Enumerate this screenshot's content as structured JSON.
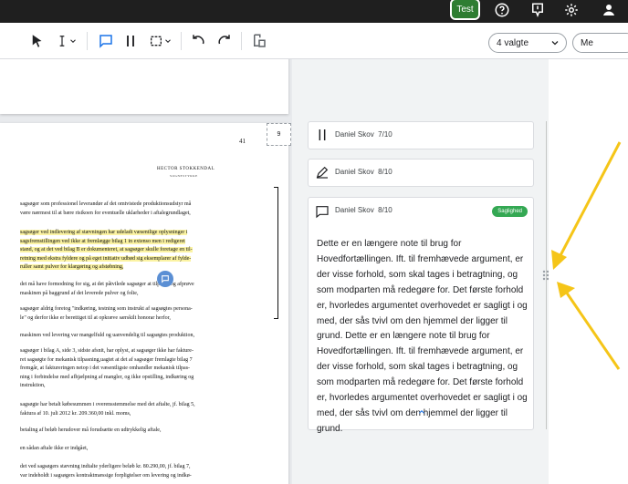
{
  "topbar": {
    "test_label": "Test",
    "icons": [
      "help-icon",
      "feedback-icon",
      "settings-icon",
      "account-icon"
    ]
  },
  "toolbar": {
    "icons": [
      "pointer-icon",
      "text-cursor-icon",
      "comment-icon",
      "columns-icon",
      "selection-icon",
      "undo-icon",
      "redo-icon",
      "export-icon"
    ],
    "filter_select": "4 valgte",
    "user_select": "Me"
  },
  "document": {
    "page_number": "41",
    "page_box": "9",
    "header_line1": "HECTOR STOKKENDAL",
    "header_line2": "SOGNESTYRKE",
    "paragraphs": [
      "sagsøger som professionel leverandør af det omtvistede produktionsudstyr må\nvære nærmest til at bære risikoen for eventuelle uklarheder i aftalegrundlaget,",
      "sagsøger ved indlevering af stævningen har udeladt væsentlige oplysninger i\nsagsfremstillingen ved ikke at fremlægge bilag 1 in extenso men i redigeret\nstand, og at det ved bilag B er dokumenteret, at sagsøger skulle foretage en til-\nretning med ekstra fyldere og på eget initiativ udbød sig eksemplarer af fylde-\nruller samt pulver for klargøring og afstøbning,",
      "det må have formodning for sig, at det påtvilede sagsøger at tilpasse og afprøve\nmaskinen på baggrund af det leverede pulver og folie,",
      "sagsøger aldrig foretog \"indkøring, testning som instrukt af sagsøgtes persona-\nle\" og derfor ikke er berettiget til at opkræve særskilt honorar herfor,",
      "maskinen ved levering var mangelfuld og uanvendelig til sagsøgtes produktion,",
      "sagsøger i bilag A, side 3, sidste afsnit, har oplyst, at sagsøger ikke har fakture-\nret sagsøgte for mekanisk tilpasning,uagtet at det af sagsøger fremlagte bilag 7\nfremgår, at faktureringen netop i det væsentligste omhandler mekanisk tilpas-\nning i forbindelse med afhjælpning af mangler, og ikke opstilling, indkøring og\ninstruktion,",
      "sagsøgte har betalt købesummen i overensstemmelse med det aftalte, jf. bilag 5,\nfaktura af 10. juli 2012 kr. 209.360,00 inkl. moms,",
      "betaling af beløb herudover må forudsætte en udtrykkelig aftale,",
      "en sådan aftale ikke er indgået,",
      "det ved sagsøgers stævning indtalte yderligere beløb kr. 80.290,00, jf. bilag 7,\nvar indeholdt i sagsøgers kontraktmæssige forpligtelser om levering og indkø-"
    ]
  },
  "notes": [
    {
      "icon": "pause-bars-icon",
      "author": "Daniel Skov",
      "score": "7/10"
    },
    {
      "icon": "pen-icon",
      "author": "Daniel Skov",
      "score": "8/10"
    },
    {
      "icon": "comment-icon",
      "author": "Daniel Skov",
      "score": "8/10",
      "badge": "Saglighed",
      "body": "Dette er en længere note til brug for Hovedfortællingen. Ift. til fremhævede argument, er der visse forhold, som skal tages i betragtning, og som modparten må redegøre for. Det første forhold er, hvorledes argumentet overhovedet er sagligt i og med, der sås tvivl om den hjemmel der ligger til grund. Dette er en længere note til brug for Hovedfortællingen. Ift. til fremhævede argument, er der visse forhold, som skal tages i betragtning, og som modparten må redegøre for. Det første forhold er, hvorledes argumentet overhovedet er sagligt i og med, der sås tvivl om den hjemmel der ligger til grund."
    }
  ],
  "colors": {
    "topbar": "#1f1f1f",
    "test_button": "#2e7d32",
    "highlight": "#fbf3a3",
    "badge": "#34a853",
    "annotation_arrow": "#f5c518"
  }
}
